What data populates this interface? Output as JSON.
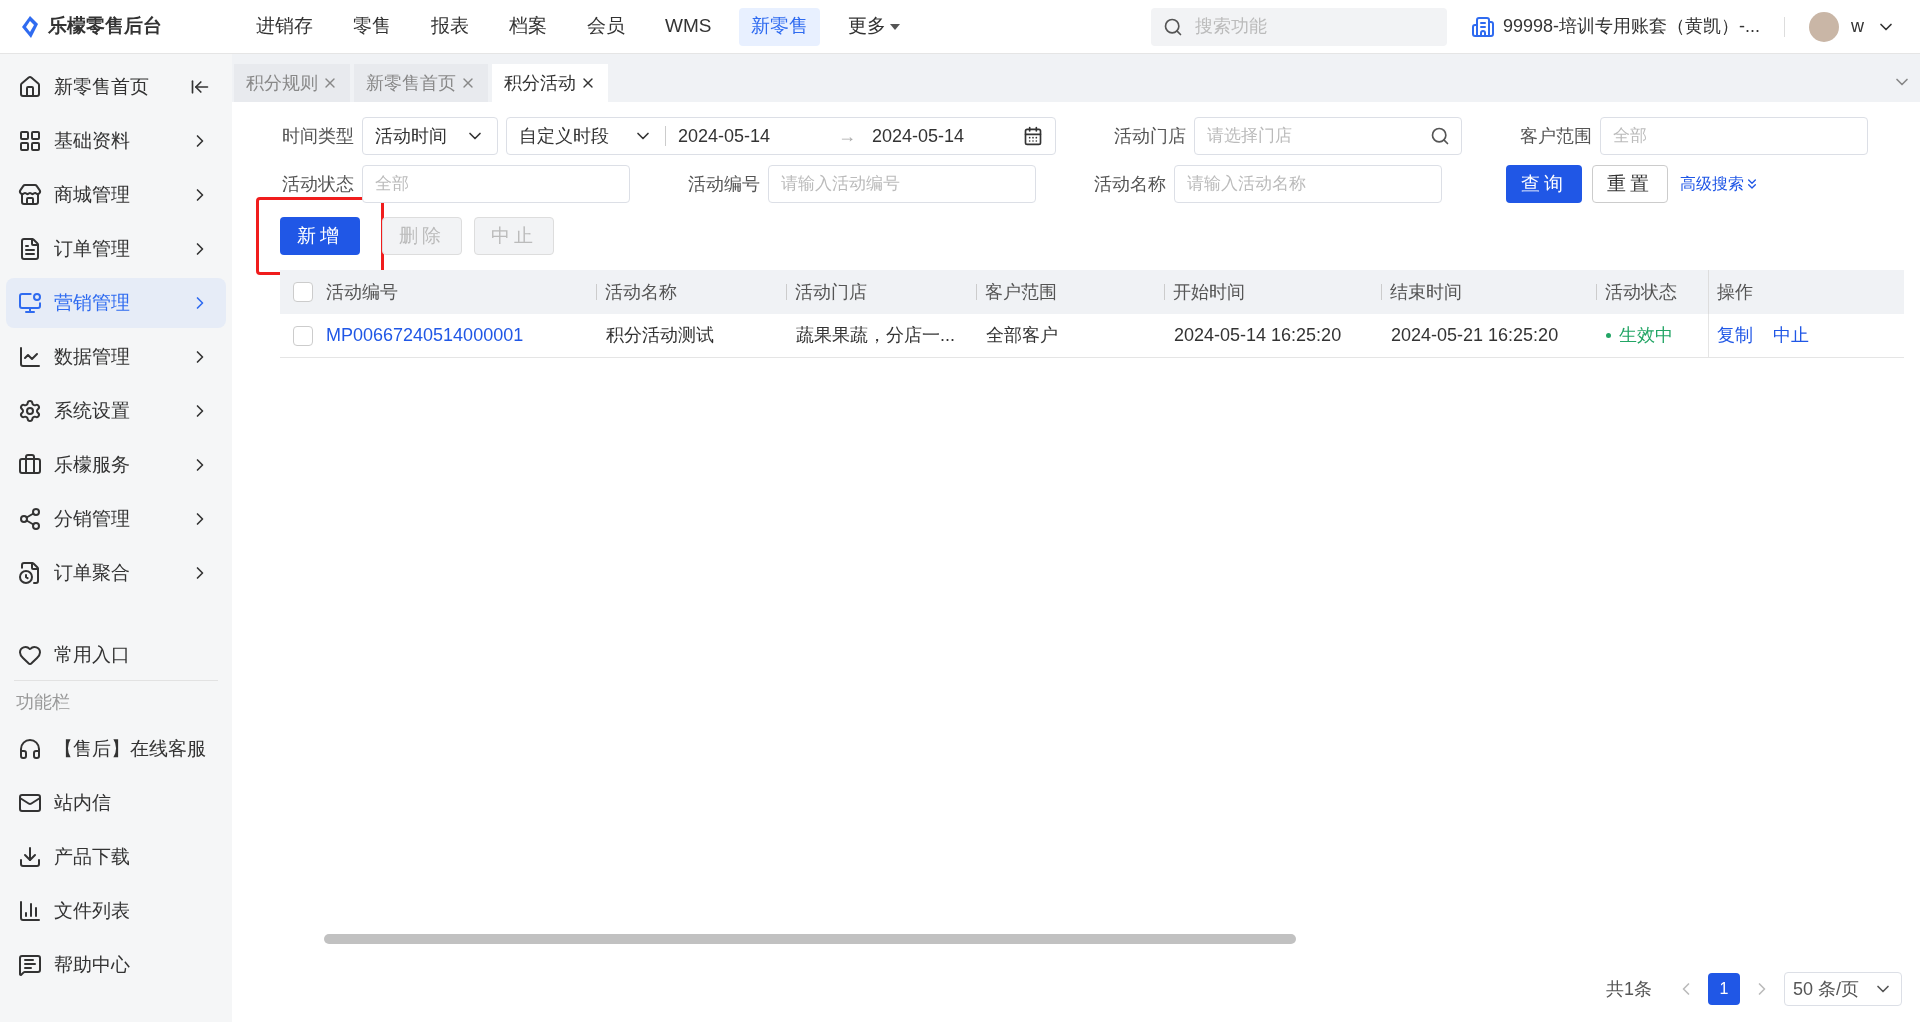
{
  "brand": "乐檬零售后台",
  "nav": [
    {
      "label": "进销存",
      "selected": false
    },
    {
      "label": "零售",
      "selected": false
    },
    {
      "label": "报表",
      "selected": false
    },
    {
      "label": "档案",
      "selected": false
    },
    {
      "label": "会员",
      "selected": false
    },
    {
      "label": "WMS",
      "selected": false
    },
    {
      "label": "新零售",
      "selected": true
    },
    {
      "label": "更多",
      "selected": false,
      "kind": "dropdown"
    }
  ],
  "search": {
    "placeholder": "搜索功能"
  },
  "account": "99998-培训专用账套（黄凯）-...",
  "user": "w",
  "sidebar": {
    "items": [
      {
        "label": "新零售首页",
        "kind": "home",
        "selected": false
      },
      {
        "label": "基础资料",
        "kind": "menu",
        "selected": false
      },
      {
        "label": "商城管理",
        "kind": "menu",
        "selected": false
      },
      {
        "label": "订单管理",
        "kind": "menu",
        "selected": false
      },
      {
        "label": "营销管理",
        "kind": "menu",
        "selected": true
      },
      {
        "label": "数据管理",
        "kind": "menu",
        "selected": false
      },
      {
        "label": "系统设置",
        "kind": "menu",
        "selected": false
      },
      {
        "label": "乐檬服务",
        "kind": "menu",
        "selected": false
      },
      {
        "label": "分销管理",
        "kind": "menu",
        "selected": false
      },
      {
        "label": "订单聚合",
        "kind": "menu",
        "selected": false
      }
    ],
    "favorites": {
      "label": "常用入口"
    },
    "section": "功能栏",
    "tools": [
      {
        "label": "【售后】在线客服"
      },
      {
        "label": "站内信"
      },
      {
        "label": "产品下载"
      },
      {
        "label": "文件列表"
      },
      {
        "label": "帮助中心"
      }
    ]
  },
  "tabs": [
    {
      "label": "积分规则",
      "selected": false
    },
    {
      "label": "新零售首页",
      "selected": false
    },
    {
      "label": "积分活动",
      "selected": true
    }
  ],
  "filters": {
    "time_type": {
      "label": "时间类型",
      "value": "活动时间"
    },
    "period": {
      "value": "自定义时段",
      "start": "2024-05-14",
      "separator": "→",
      "end": "2024-05-14"
    },
    "store": {
      "label": "活动门店",
      "placeholder": "请选择门店"
    },
    "customer_scope": {
      "label": "客户范围",
      "placeholder": "全部"
    },
    "status": {
      "label": "活动状态",
      "placeholder": "全部"
    },
    "code": {
      "label": "活动编号",
      "placeholder": "请输入活动编号"
    },
    "name": {
      "label": "活动名称",
      "placeholder": "请输入活动名称"
    },
    "query": "查询",
    "reset": "重置",
    "advanced": "高级搜索"
  },
  "actions": [
    {
      "label": "新增",
      "disabled": false,
      "highlighted": true
    },
    {
      "label": "删除",
      "disabled": true,
      "highlighted": false
    },
    {
      "label": "中止",
      "disabled": true,
      "highlighted": false
    }
  ],
  "table": {
    "all_checked": false,
    "columns": [
      "活动编号",
      "活动名称",
      "活动门店",
      "客户范围",
      "开始时间",
      "结束时间",
      "活动状态",
      "操作"
    ],
    "rows": [
      {
        "checked": false,
        "code": "MP00667240514000001",
        "name": "积分活动测试",
        "store": "蔬果果蔬，分店一...",
        "scope": "全部客户",
        "start": "2024-05-14 16:25:20",
        "end": "2024-05-21 16:25:20",
        "status": "生效中",
        "ops": [
          "复制",
          "中止"
        ]
      }
    ]
  },
  "pagination": {
    "total": "共1条",
    "pages": [
      {
        "label": "1",
        "selected": true
      }
    ],
    "page_size": "50 条/页"
  }
}
